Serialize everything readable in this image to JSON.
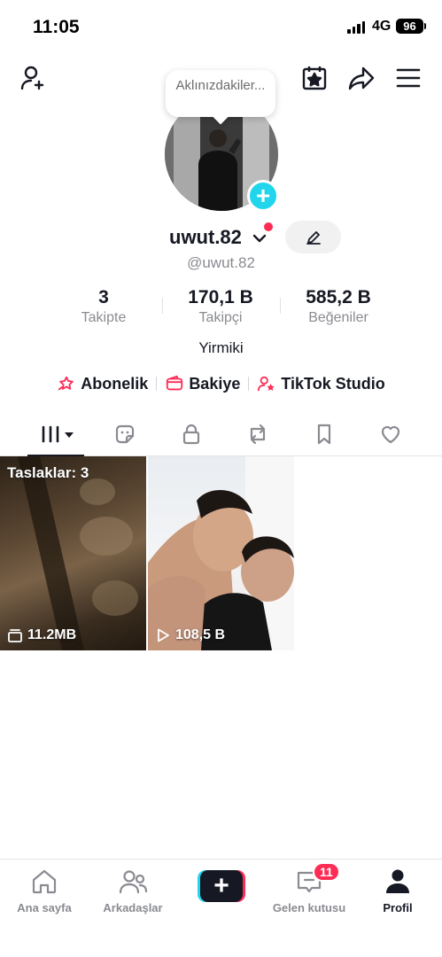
{
  "status_bar": {
    "time": "11:05",
    "network": "4G",
    "battery": "96"
  },
  "bubble": {
    "text": "Aklınızdakiler..."
  },
  "profile": {
    "username": "uwut.82",
    "handle": "@uwut.82",
    "bio": "Yirmiki"
  },
  "stats": [
    {
      "value": "3",
      "label": "Takipte"
    },
    {
      "value": "170,1 B",
      "label": "Takipçi"
    },
    {
      "value": "585,2 B",
      "label": "Beğeniler"
    }
  ],
  "links": [
    {
      "label": "Abonelik",
      "icon": "star-heart-icon"
    },
    {
      "label": "Bakiye",
      "icon": "wallet-icon"
    },
    {
      "label": "TikTok Studio",
      "icon": "creator-icon"
    }
  ],
  "tabs": [
    {
      "name": "videos",
      "icon": "grid-icon"
    },
    {
      "name": "stickers",
      "icon": "sticker-icon"
    },
    {
      "name": "private",
      "icon": "lock-icon"
    },
    {
      "name": "reposts",
      "icon": "repost-icon"
    },
    {
      "name": "favorites",
      "icon": "bookmark-icon"
    },
    {
      "name": "liked",
      "icon": "heart-icon"
    }
  ],
  "videos": [
    {
      "top_label": "Taslaklar: 3",
      "bottom_label": "11.2MB",
      "icon": "drafts-icon"
    },
    {
      "top_label": "",
      "bottom_label": "108,5 B",
      "icon": "play-icon"
    }
  ],
  "bottom_nav": [
    {
      "label": "Ana sayfa",
      "icon": "home-icon"
    },
    {
      "label": "Arkadaşlar",
      "icon": "friends-icon"
    },
    {
      "label": "",
      "icon": "create-icon"
    },
    {
      "label": "Gelen kutusu",
      "icon": "inbox-icon",
      "badge": "11"
    },
    {
      "label": "Profil",
      "icon": "profile-icon",
      "active": true
    }
  ],
  "colors": {
    "accent": "#fe2c55",
    "cyan": "#20d5ec",
    "text": "#161823",
    "muted": "#8a8b91"
  }
}
